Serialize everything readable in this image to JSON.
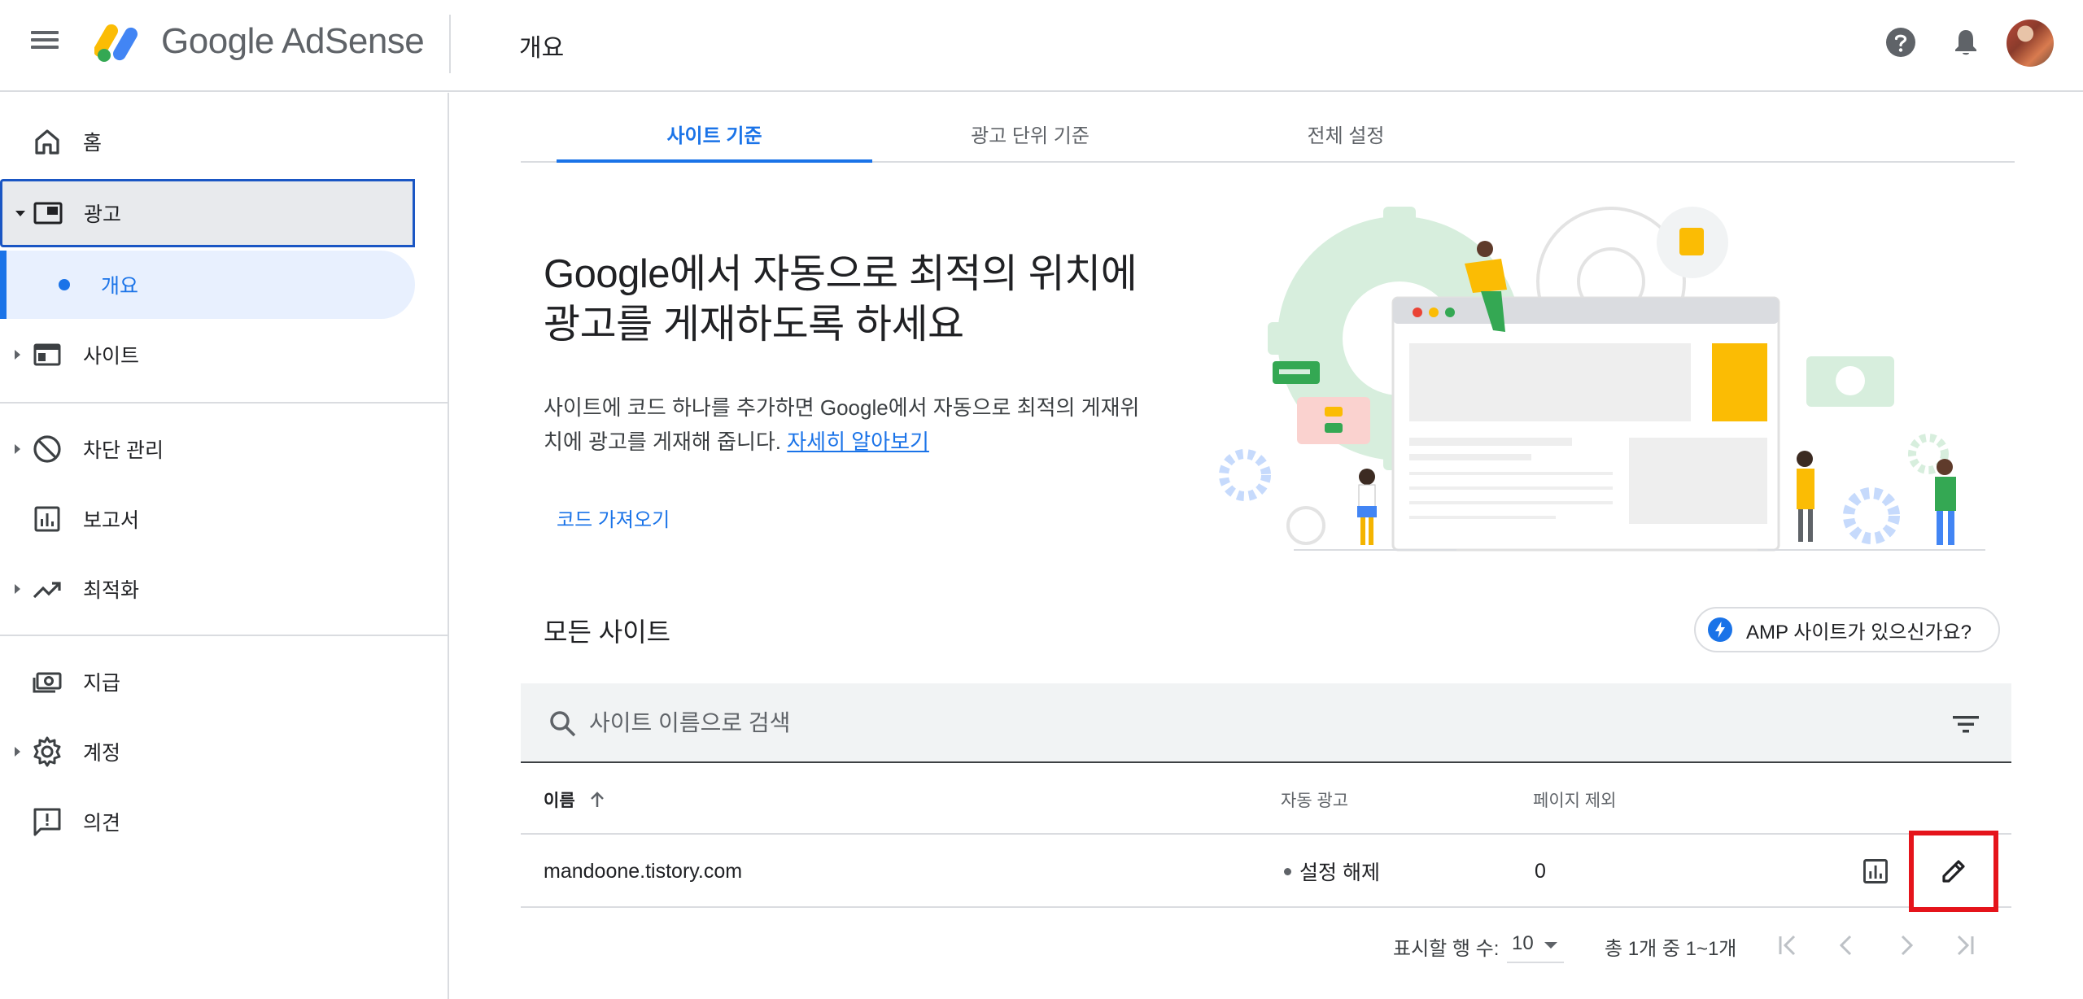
{
  "header": {
    "logo_text": "Google AdSense",
    "page_title": "개요"
  },
  "sidebar": {
    "items": [
      {
        "label": "홈",
        "icon": "home-icon"
      },
      {
        "label": "광고",
        "icon": "ads-icon",
        "expanded": true
      },
      {
        "label": "개요",
        "icon": "dot-icon",
        "active": true
      },
      {
        "label": "사이트",
        "icon": "site-icon"
      },
      {
        "label": "차단 관리",
        "icon": "block-icon"
      },
      {
        "label": "보고서",
        "icon": "report-icon"
      },
      {
        "label": "최적화",
        "icon": "trending-icon"
      },
      {
        "label": "지급",
        "icon": "payment-icon"
      },
      {
        "label": "계정",
        "icon": "gear-icon"
      },
      {
        "label": "의견",
        "icon": "feedback-icon"
      }
    ]
  },
  "tabs": [
    {
      "label": "사이트 기준",
      "active": true
    },
    {
      "label": "광고 단위 기준",
      "active": false
    },
    {
      "label": "전체 설정",
      "active": false
    }
  ],
  "promo": {
    "heading_line1": "Google에서 자동으로 최적의 위치에",
    "heading_line2": "광고를 게재하도록 하세요",
    "body_line1": "사이트에 코드 하나를 추가하면 Google에서 자동으로 최적의 게재위",
    "body_line2": "치에 광고를 게재해 줍니다. ",
    "link": "자세히 알아보기",
    "get_code": "코드 가져오기"
  },
  "sites": {
    "title": "모든 사이트",
    "amp_button": "AMP 사이트가 있으신가요?",
    "search_placeholder": "사이트 이름으로 검색",
    "columns": {
      "name": "이름",
      "auto_ads": "자동 광고",
      "excluded_pages": "페이지 제외"
    },
    "rows": [
      {
        "name": "mandoone.tistory.com",
        "auto_ads": "설정 해제",
        "excluded_pages": "0"
      }
    ],
    "pagination": {
      "rows_label": "표시할 행 수:",
      "rows_value": "10",
      "range": "총 1개 중 1~1개"
    }
  },
  "colors": {
    "accent": "#1a73e8",
    "highlight_box": "#e5141b",
    "ads_item_border": "#1a56c4"
  }
}
